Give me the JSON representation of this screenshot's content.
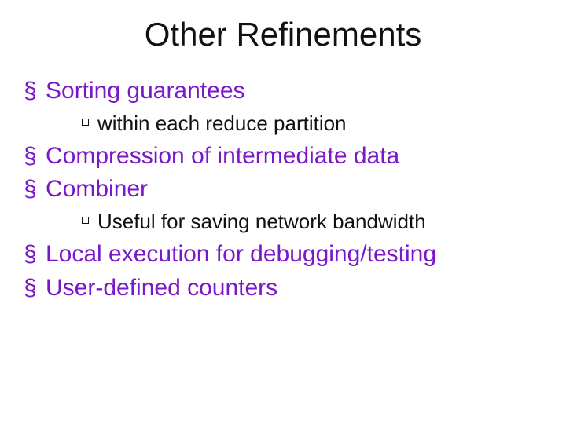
{
  "title": "Other Refinements",
  "bullets": {
    "b1": "Sorting guarantees",
    "b1_sub1": "within each reduce partition",
    "b2": "Compression of intermediate data",
    "b3": "Combiner",
    "b3_sub1": "Useful for saving network bandwidth",
    "b4": "Local execution for debugging/testing",
    "b5": "User-defined counters"
  }
}
